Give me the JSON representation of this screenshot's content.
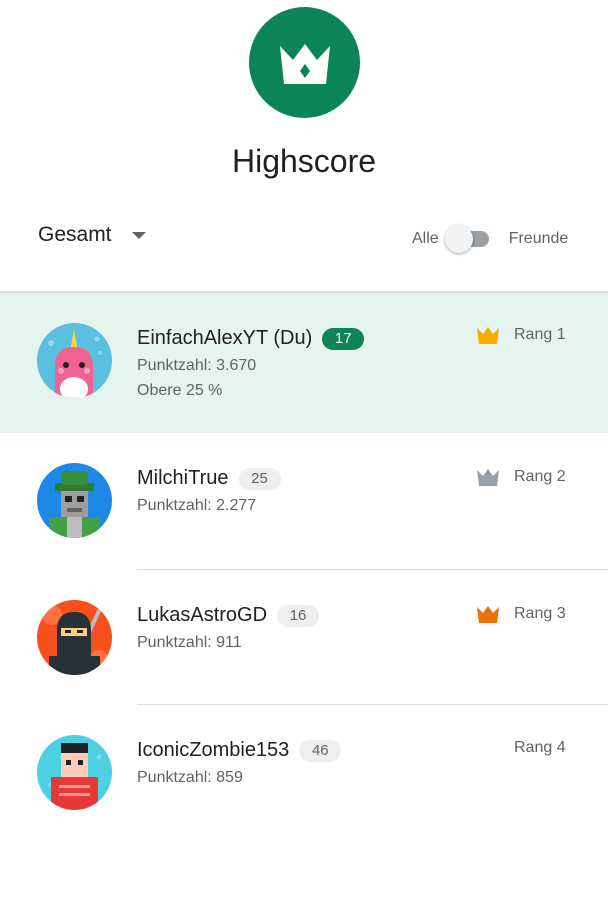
{
  "header": {
    "title": "Highscore",
    "logo_icon": "crown-icon",
    "accent_color": "#0b8457"
  },
  "controls": {
    "filter_label": "Gesamt",
    "toggle_left_label": "Alle",
    "toggle_right_label": "Freunde",
    "toggle_state": "Alle"
  },
  "players": [
    {
      "name": "EinfachAlexYT (Du)",
      "level": "17",
      "score": "Punktzahl: 3.670",
      "percentile": "Obere 25 %",
      "rank": "Rang 1",
      "crown_color": "#f9ab00",
      "avatar": "narwhal-avatar",
      "is_current_user": true
    },
    {
      "name": "MilchiTrue",
      "level": "25",
      "score": "Punktzahl: 2.277",
      "rank": "Rang 2",
      "crown_color": "#9aa0a6",
      "avatar": "robot-avatar"
    },
    {
      "name": "LukasAstroGD",
      "level": "16",
      "score": "Punktzahl: 911",
      "rank": "Rang 3",
      "crown_color": "#e8710a",
      "avatar": "ninja-avatar"
    },
    {
      "name": "IconicZombie153",
      "level": "46",
      "score": "Punktzahl: 859",
      "rank": "Rang 4",
      "avatar": "zombie-avatar"
    }
  ]
}
